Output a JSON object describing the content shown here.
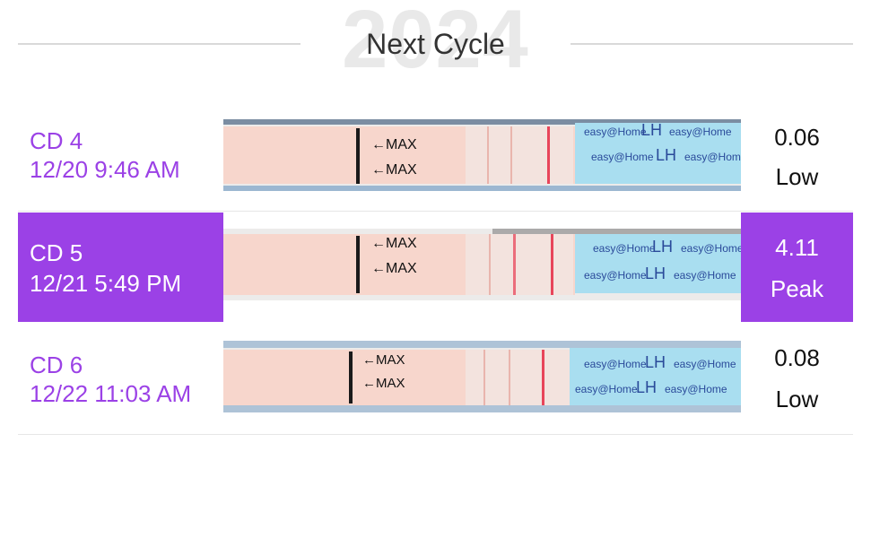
{
  "header": {
    "year": "2024",
    "title": "Next Cycle"
  },
  "strip_text": {
    "max": "←MAX",
    "brand": "easy@Home",
    "lh": "LH"
  },
  "colors": {
    "accent": "#9b41e6",
    "test_line": "#e8455a",
    "strip": "#f7d6cc",
    "tab": "#a9def0"
  },
  "rows": [
    {
      "cd": "CD 4",
      "datetime": "12/20 9:46 AM",
      "value": "0.06",
      "level": "Low",
      "selected": false
    },
    {
      "cd": "CD 5",
      "datetime": "12/21 5:49 PM",
      "value": "4.11",
      "level": "Peak",
      "selected": true
    },
    {
      "cd": "CD 6",
      "datetime": "12/22 11:03 AM",
      "value": "0.08",
      "level": "Low",
      "selected": false
    }
  ]
}
